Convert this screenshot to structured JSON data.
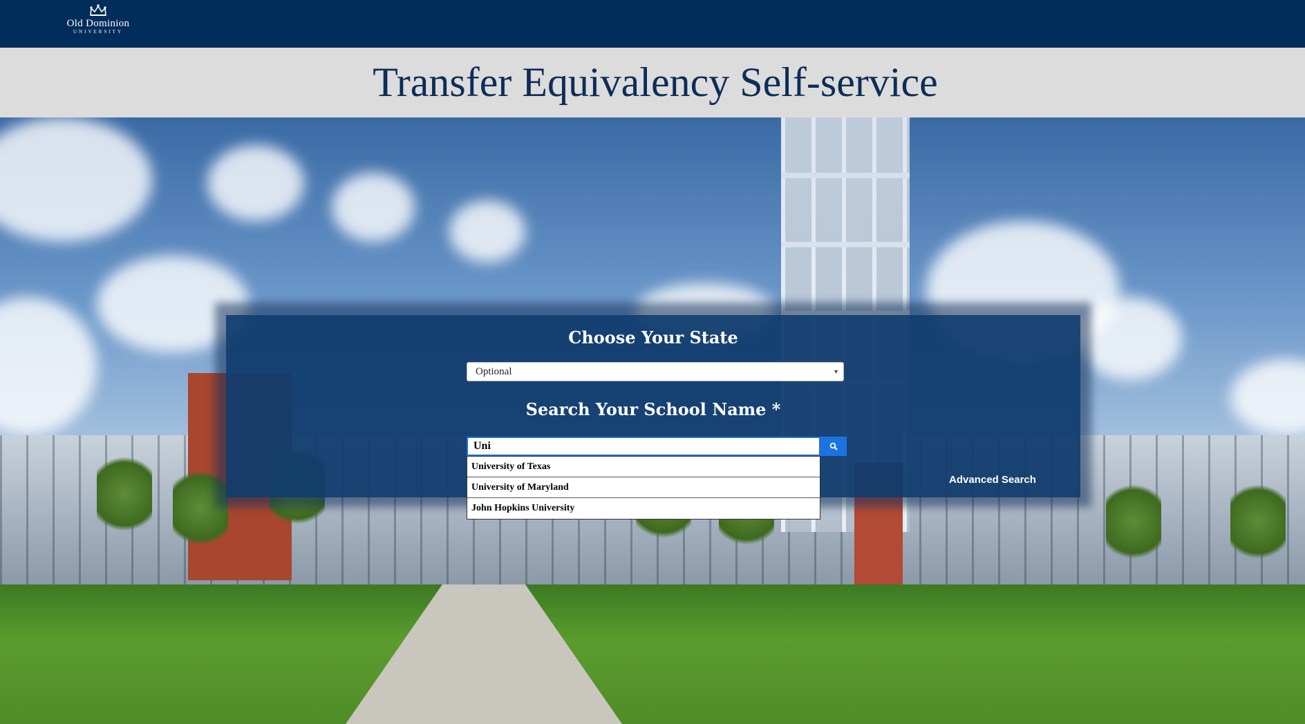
{
  "header": {
    "logo_line1": "Old Dominion",
    "logo_line2": "UNIVERSITY",
    "logo_icon": "crown-icon",
    "background_color": "#002d5a"
  },
  "title_band": {
    "title": "Transfer Equivalency Self-service",
    "background_color": "#dcdcdc",
    "text_color": "#0d2d57"
  },
  "search_panel": {
    "state_heading": "Choose Your State",
    "state_select": {
      "selected": "Optional"
    },
    "school_heading": "Search Your School Name *",
    "school_search": {
      "value": "Uni"
    },
    "search_button_icon": "search-icon",
    "advanced_search_label": "Advanced Search",
    "accent_color": "#1a73e0"
  },
  "autocomplete": {
    "items": [
      {
        "label": "University of Texas"
      },
      {
        "label": "University of Maryland"
      },
      {
        "label": "John Hopkins University"
      }
    ]
  }
}
